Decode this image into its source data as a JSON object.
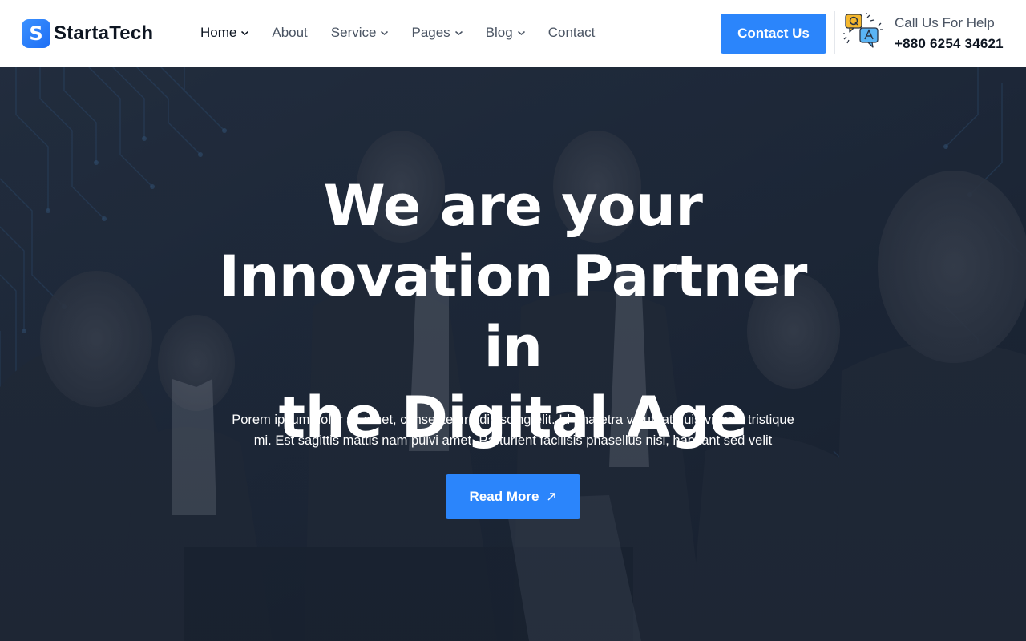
{
  "brand": {
    "name": "StartaTech",
    "logo_letter": "S"
  },
  "nav": {
    "items": [
      {
        "label": "Home",
        "has_dropdown": true,
        "active": true
      },
      {
        "label": "About",
        "has_dropdown": false
      },
      {
        "label": "Service",
        "has_dropdown": true
      },
      {
        "label": "Pages",
        "has_dropdown": true
      },
      {
        "label": "Blog",
        "has_dropdown": true
      },
      {
        "label": "Contact",
        "has_dropdown": false
      }
    ]
  },
  "header_cta": {
    "contact_label": "Contact Us"
  },
  "help": {
    "label": "Call Us For Help",
    "phone": "+880 6254 34621",
    "icon": "qa-chat-icon"
  },
  "hero": {
    "title_lines": [
      "We are your",
      "Innovation Partner in",
      "the Digital Age"
    ],
    "description_lines": [
      "Porem ipsum dolor sit amet, consectetur adipiscing elit. Id pharetra volutpat quis viverra tristique",
      "mi. Est sagittis mattis nam pulvi amet. Parturient facilisis phasellus nisi, habitant sed velit"
    ],
    "button_label": "Read More",
    "button_icon": "arrow-up-right-icon"
  },
  "colors": {
    "accent": "#2b85fb",
    "heading": "#0d1521",
    "muted": "#4a5463",
    "hero_overlay": "#1b2535"
  }
}
